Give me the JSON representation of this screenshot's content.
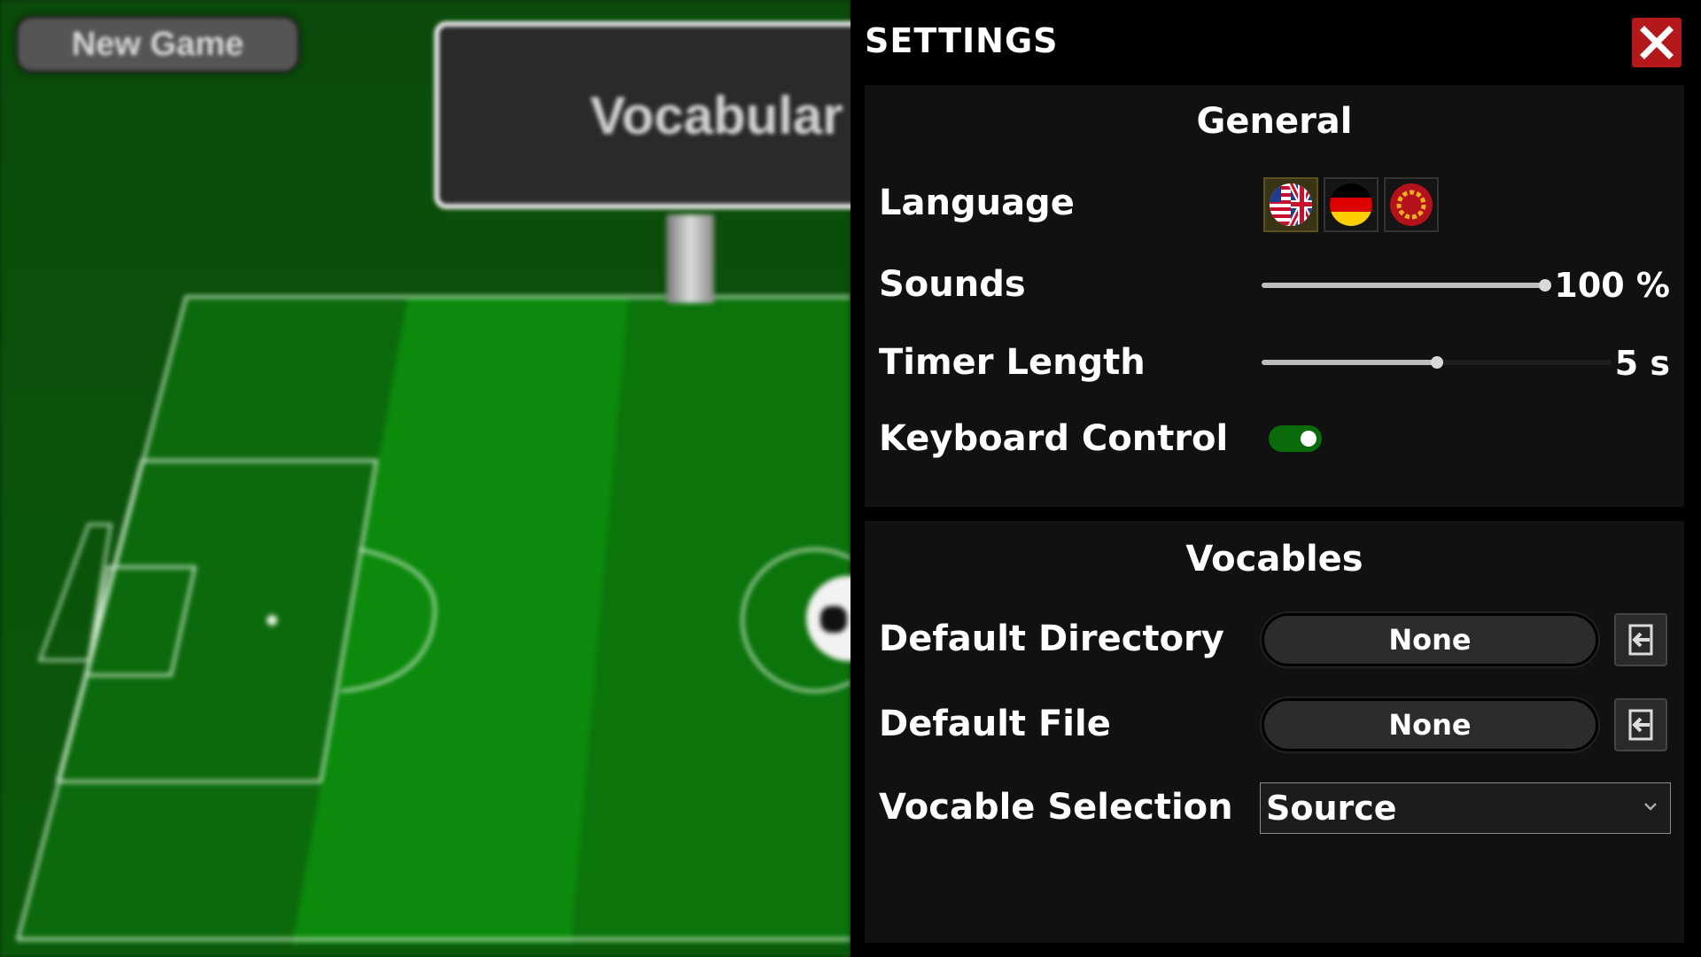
{
  "game": {
    "new_game_label": "New Game",
    "scoreboard_text": "Vocabular"
  },
  "settings": {
    "title": "SETTINGS",
    "close_icon": "close-icon",
    "general": {
      "title": "General",
      "language": {
        "label": "Language",
        "options": [
          {
            "name": "english",
            "icon": "uk-us-flag-icon",
            "selected": true
          },
          {
            "name": "german",
            "icon": "german-flag-icon",
            "selected": false
          },
          {
            "name": "latin",
            "icon": "laurel-wreath-icon",
            "selected": false
          }
        ]
      },
      "sounds": {
        "label": "Sounds",
        "value_percent": 100,
        "value_text": "100 %"
      },
      "timer_length": {
        "label": "Timer Length",
        "value_fraction": 0.5,
        "value_text": "5 s"
      },
      "keyboard_control": {
        "label": "Keyboard Control",
        "enabled": true
      }
    },
    "vocables": {
      "title": "Vocables",
      "default_directory": {
        "label": "Default Directory",
        "value": "None",
        "button_icon": "browse-icon"
      },
      "default_file": {
        "label": "Default File",
        "value": "None",
        "button_icon": "browse-icon"
      },
      "vocable_selection": {
        "label": "Vocable Selection",
        "value": "Source"
      }
    }
  },
  "colors": {
    "close_button": "#b3191b",
    "toggle_on": "#0a6b0a",
    "field_green": "#0a7a0a"
  }
}
